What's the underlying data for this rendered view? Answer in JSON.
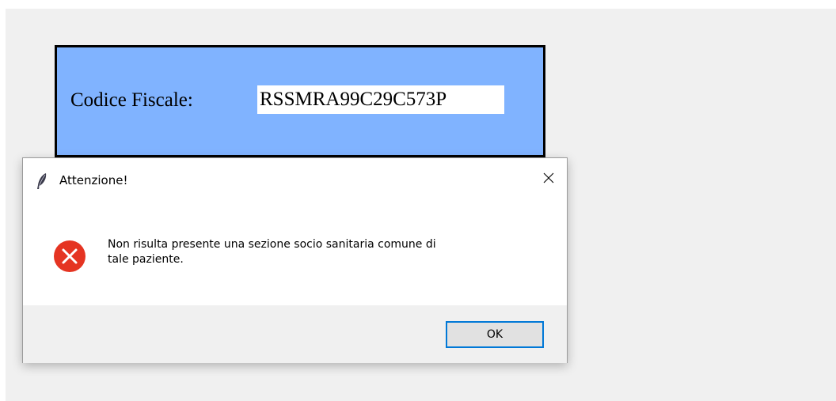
{
  "main_window": {
    "codice_fiscale": {
      "label": "Codice Fiscale:",
      "value": "RSSMRA99C29C573P"
    },
    "panel_color": "#80b3ff"
  },
  "dialog": {
    "title": "Attenzione!",
    "title_icon": "feather-icon",
    "close_icon": "close-icon",
    "status_icon": "error-icon",
    "error_color": "#e81123",
    "message_line1": "Non risulta presente una sezione socio sanitaria comune di",
    "message_line2": "tale paziente.",
    "ok_label": "OK",
    "ok_border_color": "#0078d7"
  }
}
